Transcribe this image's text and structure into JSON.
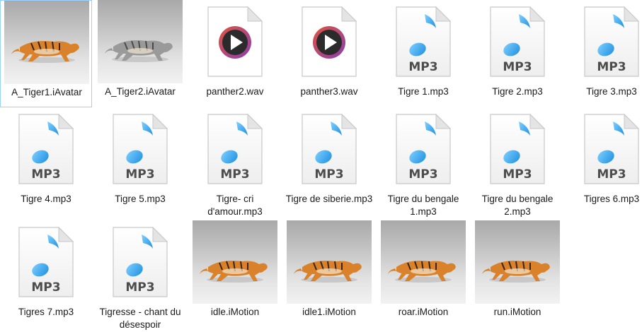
{
  "files": [
    {
      "name": "A_Tiger1.iAvatar",
      "kind": "tiger-photo",
      "tint": "orange",
      "selected": true
    },
    {
      "name": "A_Tiger2.iAvatar",
      "kind": "tiger-photo",
      "tint": "grey",
      "selected": false
    },
    {
      "name": "panther2.wav",
      "kind": "wav",
      "selected": false
    },
    {
      "name": "panther3.wav",
      "kind": "wav",
      "selected": false
    },
    {
      "name": "Tigre 1.mp3",
      "kind": "mp3",
      "selected": false
    },
    {
      "name": "Tigre 2.mp3",
      "kind": "mp3",
      "selected": false
    },
    {
      "name": "Tigre 3.mp3",
      "kind": "mp3",
      "selected": false
    },
    {
      "name": "Tigre 4.mp3",
      "kind": "mp3",
      "selected": false
    },
    {
      "name": "Tigre 5.mp3",
      "kind": "mp3",
      "selected": false
    },
    {
      "name": "Tigre- cri d'amour.mp3",
      "kind": "mp3",
      "selected": false
    },
    {
      "name": "Tigre de siberie.mp3",
      "kind": "mp3",
      "selected": false
    },
    {
      "name": "Tigre du bengale 1.mp3",
      "kind": "mp3",
      "selected": false
    },
    {
      "name": "Tigre du bengale 2.mp3",
      "kind": "mp3",
      "selected": false
    },
    {
      "name": "Tigres 6.mp3",
      "kind": "mp3",
      "selected": false
    },
    {
      "name": "Tigres 7.mp3",
      "kind": "mp3",
      "selected": false
    },
    {
      "name": "Tigresse - chant du désespoir",
      "kind": "mp3",
      "selected": false
    },
    {
      "name": "idle.iMotion",
      "kind": "tiger-photo",
      "tint": "orange",
      "selected": false
    },
    {
      "name": "idle1.iMotion",
      "kind": "tiger-photo",
      "tint": "orange",
      "selected": false
    },
    {
      "name": "roar.iMotion",
      "kind": "tiger-photo",
      "tint": "orange",
      "selected": false
    },
    {
      "name": "run.iMotion",
      "kind": "tiger-photo",
      "tint": "orange",
      "selected": false
    }
  ],
  "icons": {
    "mp3_badge": "MP3",
    "mp3_icon": "music-note-document-icon",
    "wav_icon": "media-player-document-icon",
    "tiger_icon": "tiger-thumbnail"
  },
  "colors": {
    "note_blue": "#1e8fe0",
    "player_ring": "#e0533f",
    "player_ring2": "#8a3fb0",
    "selection_border": "#99d1ff",
    "tiger_orange": "#d9822b",
    "tiger_grey": "#9a9a9a"
  }
}
